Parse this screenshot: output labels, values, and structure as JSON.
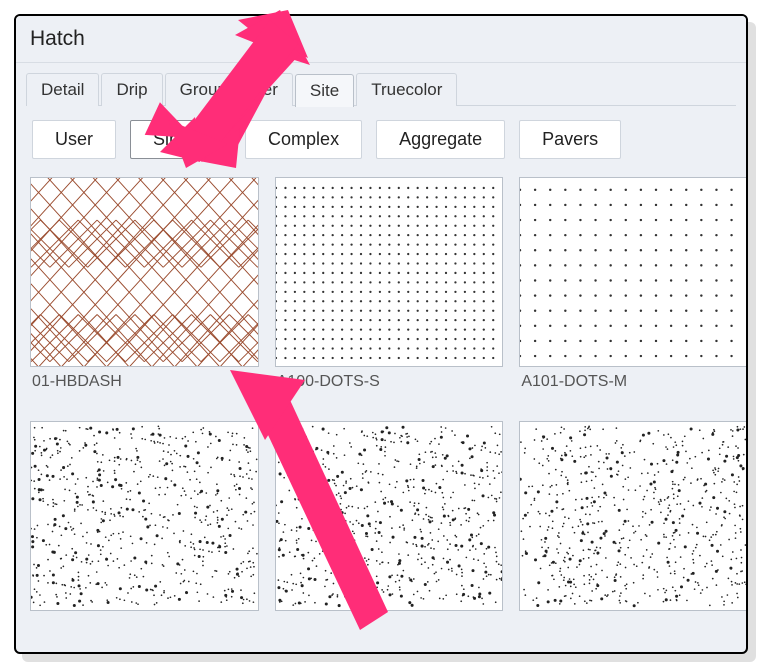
{
  "window": {
    "title": "Hatch"
  },
  "tabs": [
    {
      "label": "Detail",
      "active": false
    },
    {
      "label": "Drip",
      "active": false
    },
    {
      "label": "Groundcover",
      "active": false
    },
    {
      "label": "Site",
      "active": true
    },
    {
      "label": "Truecolor",
      "active": false
    }
  ],
  "buttons": [
    {
      "label": "User",
      "active": false
    },
    {
      "label": "Simple",
      "active": true
    },
    {
      "label": "Complex",
      "active": false
    },
    {
      "label": "Aggregate",
      "active": false
    },
    {
      "label": "Pavers",
      "active": false
    }
  ],
  "thumbs_row1": [
    {
      "caption": "01-HBDASH",
      "kind": "herringbone"
    },
    {
      "caption": "A100-DOTS-S",
      "kind": "dots-s"
    },
    {
      "caption": "A101-DOTS-M",
      "kind": "dots-m"
    }
  ],
  "thumbs_row2": [
    {
      "caption": "",
      "kind": "scatter"
    },
    {
      "caption": "",
      "kind": "scatter"
    },
    {
      "caption": "",
      "kind": "scatter"
    }
  ],
  "annotation_color": "#ff2d78"
}
